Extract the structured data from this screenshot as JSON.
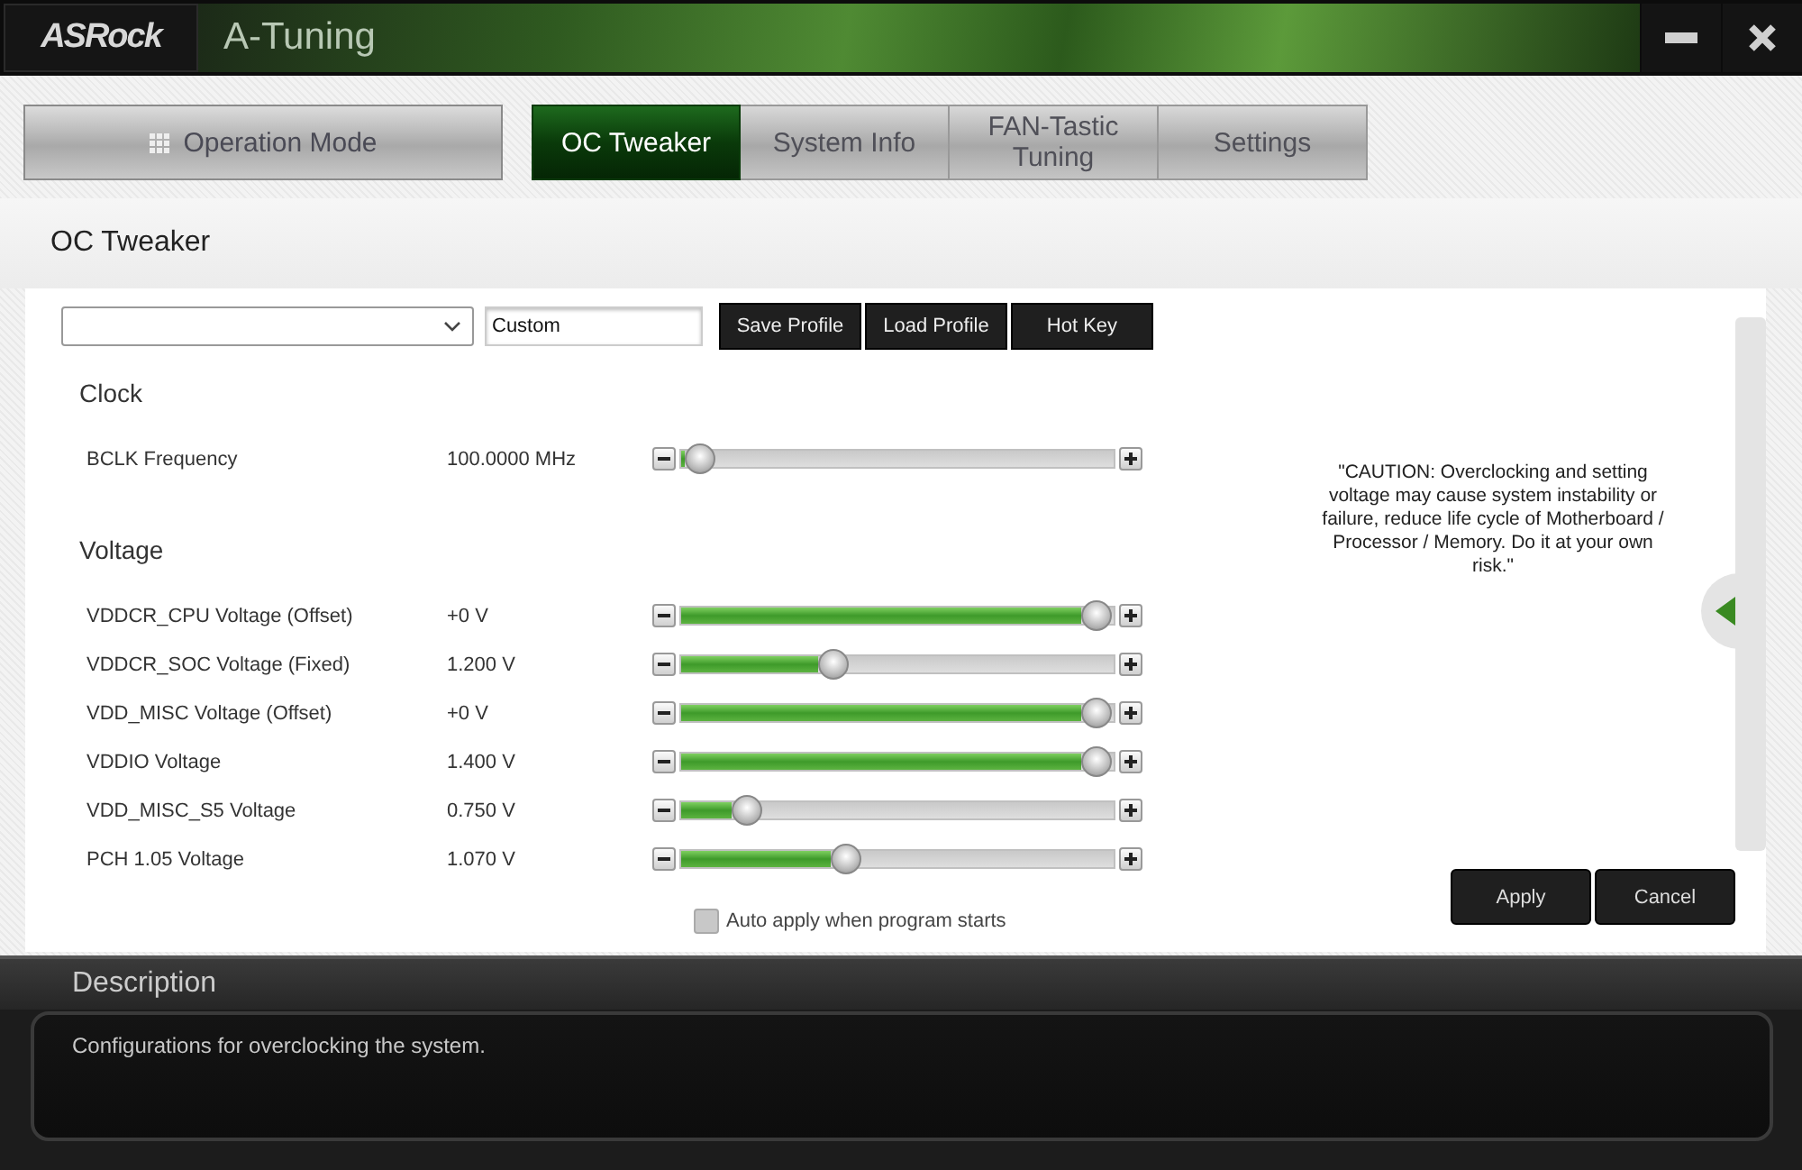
{
  "window": {
    "logo": "ASRock",
    "title": "A-Tuning"
  },
  "operation_mode": {
    "label": "Operation Mode"
  },
  "tabs": [
    {
      "label": "OC Tweaker",
      "selected": true
    },
    {
      "label": "System Info",
      "selected": false
    },
    {
      "label": "FAN-Tastic Tuning",
      "selected": false
    },
    {
      "label": "Settings",
      "selected": false
    }
  ],
  "page_title": "OC Tweaker",
  "profile": {
    "name_value": "Custom"
  },
  "profile_buttons": [
    "Save Profile",
    "Load Profile",
    "Hot Key"
  ],
  "sections": [
    {
      "title": "Clock",
      "settings": [
        {
          "name": "BCLK Frequency",
          "reading": "100.0000 MHz",
          "level": 0.04
        }
      ]
    },
    {
      "title": "Voltage",
      "settings": [
        {
          "name": "VDDCR_CPU Voltage (Offset)",
          "reading": "+0 V",
          "level": 0.96
        },
        {
          "name": "VDDCR_SOC Voltage (Fixed)",
          "reading": "1.200 V",
          "level": 0.35
        },
        {
          "name": "VDD_MISC Voltage (Offset)",
          "reading": "+0 V",
          "level": 0.96
        },
        {
          "name": "VDDIO Voltage",
          "reading": "1.400 V",
          "level": 0.96
        },
        {
          "name": "VDD_MISC_S5 Voltage",
          "reading": "0.750 V",
          "level": 0.15
        },
        {
          "name": "PCH 1.05 Voltage",
          "reading": "1.070 V",
          "level": 0.38
        }
      ]
    }
  ],
  "auto_apply": {
    "label": "Auto apply when program starts",
    "checked": false
  },
  "caution": "\"CAUTION: Overclocking and setting voltage may cause system instability or failure, reduce life cycle of Motherboard / Processor / Memory. Do it at your own risk.\"",
  "buttons": [
    "Apply",
    "Cancel"
  ],
  "description": {
    "title": "Description",
    "text": "Configurations for overclocking the system."
  }
}
